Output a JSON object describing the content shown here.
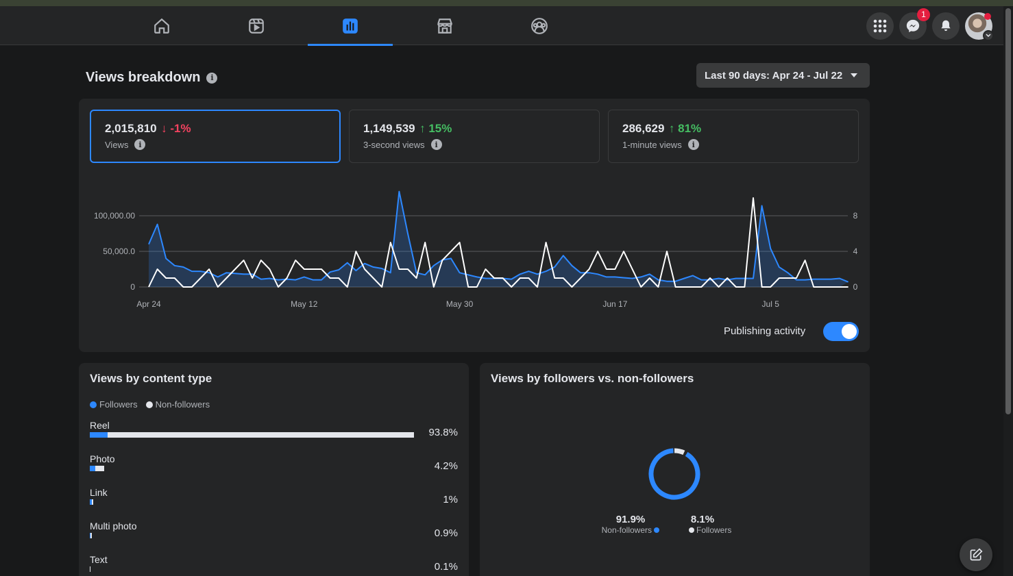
{
  "nav": {
    "tabs": [
      {
        "name": "home-icon",
        "active": false
      },
      {
        "name": "reels-icon",
        "active": false
      },
      {
        "name": "insights-icon",
        "active": true
      },
      {
        "name": "marketplace-icon",
        "active": false
      },
      {
        "name": "groups-icon",
        "active": false
      }
    ],
    "messenger_badge": "1"
  },
  "header": {
    "title": "Views breakdown",
    "date_range": "Last 90 days: Apr 24 - Jul 22"
  },
  "metrics": [
    {
      "value": "2,015,810",
      "change": "-1%",
      "direction": "down",
      "label": "Views",
      "selected": true
    },
    {
      "value": "1,149,539",
      "change": "15%",
      "direction": "up",
      "label": "3-second views",
      "selected": false
    },
    {
      "value": "286,629",
      "change": "81%",
      "direction": "up",
      "label": "1-minute views",
      "selected": false
    }
  ],
  "chart_data": {
    "type": "line",
    "x": [
      "Apr 24",
      "Apr 25",
      "Apr 26",
      "Apr 27",
      "Apr 28",
      "Apr 29",
      "Apr 30",
      "May 1",
      "May 2",
      "May 3",
      "May 4",
      "May 5",
      "May 6",
      "May 7",
      "May 8",
      "May 9",
      "May 10",
      "May 11",
      "May 12",
      "May 13",
      "May 14",
      "May 15",
      "May 16",
      "May 17",
      "May 18",
      "May 19",
      "May 20",
      "May 21",
      "May 22",
      "May 23",
      "May 24",
      "May 25",
      "May 26",
      "May 27",
      "May 28",
      "May 29",
      "May 30",
      "May 31",
      "Jun 1",
      "Jun 2",
      "Jun 3",
      "Jun 4",
      "Jun 5",
      "Jun 6",
      "Jun 7",
      "Jun 8",
      "Jun 9",
      "Jun 10",
      "Jun 11",
      "Jun 12",
      "Jun 13",
      "Jun 14",
      "Jun 15",
      "Jun 16",
      "Jun 17",
      "Jun 18",
      "Jun 19",
      "Jun 20",
      "Jun 21",
      "Jun 22",
      "Jun 23",
      "Jun 24",
      "Jun 25",
      "Jun 26",
      "Jun 27",
      "Jun 28",
      "Jun 29",
      "Jun 30",
      "Jul 1",
      "Jul 2",
      "Jul 3",
      "Jul 4",
      "Jul 5",
      "Jul 6",
      "Jul 7",
      "Jul 8",
      "Jul 9",
      "Jul 10",
      "Jul 11",
      "Jul 12",
      "Jul 13"
    ],
    "x_ticks": [
      "Apr 24",
      "May 12",
      "May 30",
      "Jun 17",
      "Jul 5"
    ],
    "y_ticks_left": [
      "100,000.00",
      "50,000.0",
      "0"
    ],
    "y_ticks_right": [
      "8",
      "4",
      "0"
    ],
    "ylim_left": [
      0,
      100000
    ],
    "ylim_right": [
      0,
      8
    ],
    "grid": true,
    "series": [
      {
        "axis": "left",
        "color": "#2d88ff",
        "fill": true,
        "values": [
          60000,
          88000,
          40000,
          30000,
          28000,
          22000,
          22000,
          20000,
          14000,
          20000,
          19000,
          18000,
          18000,
          11000,
          12000,
          10000,
          11000,
          10000,
          14000,
          10000,
          10000,
          21000,
          24000,
          34000,
          23000,
          33000,
          28000,
          26000,
          20000,
          134000,
          75000,
          20000,
          17000,
          30000,
          38000,
          40000,
          20000,
          17000,
          14000,
          12000,
          12000,
          12000,
          11000,
          18000,
          22000,
          18000,
          22000,
          28000,
          44000,
          30000,
          20000,
          20000,
          18000,
          14000,
          14000,
          13000,
          12000,
          14000,
          18000,
          10000,
          8000,
          8000,
          12000,
          16000,
          10000,
          10000,
          12000,
          10000,
          12000,
          12000,
          12000,
          114000,
          54000,
          28000,
          20000,
          10000,
          10000,
          11000,
          11000,
          11000,
          12000,
          7000
        ]
      },
      {
        "axis": "right",
        "color": "#ffffff",
        "fill": false,
        "values": [
          0,
          2,
          1,
          1,
          0,
          0,
          1,
          2,
          0,
          1,
          2,
          3,
          1,
          3,
          2,
          0,
          1,
          3,
          2,
          2,
          2,
          1,
          1,
          0,
          4,
          2,
          1,
          0,
          5,
          2,
          2,
          1,
          5,
          0,
          3,
          4,
          5,
          0,
          0,
          2,
          1,
          1,
          0,
          1,
          1,
          0,
          5,
          1,
          1,
          0,
          1,
          2,
          4,
          2,
          2,
          4,
          2,
          0,
          1,
          0,
          4,
          0,
          0,
          0,
          0,
          1,
          0,
          1,
          0,
          0,
          10,
          0,
          0,
          1,
          1,
          1,
          3,
          0,
          0,
          0,
          0,
          0
        ]
      }
    ]
  },
  "publishing_toggle": {
    "label": "Publishing activity",
    "on": true
  },
  "content_type": {
    "title": "Views by content type",
    "legend": [
      "Followers",
      "Non-followers"
    ],
    "rows": [
      {
        "label": "Reel",
        "pct": "93.8%",
        "followers": 0.055,
        "nonfollowers": 0.945
      },
      {
        "label": "Photo",
        "pct": "4.2%",
        "followers": 0.4,
        "nonfollowers": 0.6
      },
      {
        "label": "Link",
        "pct": "1%",
        "followers": 0.5,
        "nonfollowers": 0.5
      },
      {
        "label": "Multi photo",
        "pct": "0.9%",
        "followers": 0.2,
        "nonfollowers": 0.8
      },
      {
        "label": "Text",
        "pct": "0.1%",
        "followers": 0.0,
        "nonfollowers": 1.0
      }
    ]
  },
  "followers_split": {
    "title": "Views by followers vs. non-followers",
    "nonfollowers_pct": "91.9%",
    "nonfollowers_label": "Non-followers",
    "followers_pct": "8.1%",
    "followers_label": "Followers",
    "nonfollowers_value": 91.9,
    "followers_value": 8.1
  },
  "colors": {
    "accent": "#2d88ff",
    "down": "#f3425f",
    "up": "#45bd62"
  }
}
